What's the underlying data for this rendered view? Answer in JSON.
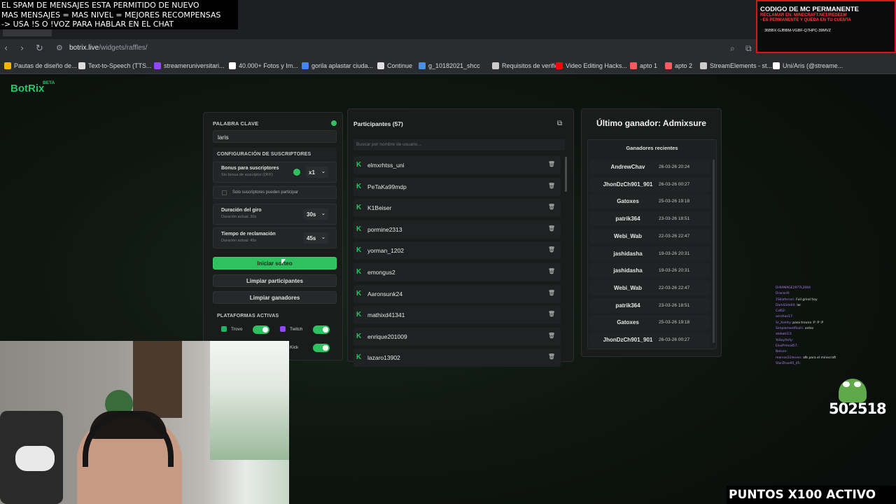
{
  "overlay": {
    "spam_lines": [
      "EL SPAM DE MENSAJES ESTA PERMITIDO DE NUEVO",
      "MAS MENSAJES = MAS NIVEL = MEJORES RECOMPENSAS",
      "-> USA !S  O !VOZ PARA HABLAR EN EL CHAT"
    ],
    "mc_title": "CODIGO DE MC PERMANENTE",
    "mc_line1": "RECLAMAR EN: MINECRAFT.NET/REDEEM",
    "mc_line2": "- ES PERMANENTE Y QUEDA EN TU CUENTA",
    "mc_code": "36BBX-GJBBM-VGBF-Q7HPC-39MVZ",
    "points_number": "502518",
    "puntos_banner": "PUNTOS X100 ACTIVO"
  },
  "browser": {
    "url_domain": "botrix.live",
    "url_path": "/widgets/raffles/",
    "bookmarks": [
      {
        "label": "Pautas de diseño de...",
        "color": "#f4b400"
      },
      {
        "label": "Text-to-Speech (TTS...",
        "color": "#dddddd"
      },
      {
        "label": "streameruniversitari...",
        "color": "#9146ff"
      },
      {
        "label": "40.000+ Fotos y Im...",
        "color": "#ffffff"
      },
      {
        "label": "gorila aplastar ciuda...",
        "color": "#4285f4"
      },
      {
        "label": "Continue",
        "color": "#e0e0e0"
      },
      {
        "label": "g_10182021_shcc",
        "color": "#4a90e2"
      },
      {
        "label": "Requisitos de verific...",
        "color": "#cccccc"
      },
      {
        "label": "Video Editing Hacks...",
        "color": "#ff0000"
      },
      {
        "label": "apto 1",
        "color": "#ff5a5f"
      },
      {
        "label": "apto 2",
        "color": "#ff5a5f"
      },
      {
        "label": "StreamElements - st...",
        "color": "#cccccc"
      },
      {
        "label": "Uni/Aris (@streame...",
        "color": "#ffffff"
      }
    ]
  },
  "brand": {
    "name": "BotRix",
    "badge": "BETA"
  },
  "settings": {
    "keyword_label": "PALABRA CLAVE",
    "keyword_value": "laris",
    "subs_section": "CONFIGURACIÓN DE SUSCRIPTORES",
    "sub_bonus_label": "Bonus para suscriptores",
    "sub_bonus_sub": "Sin bonus de suscriptor (OFF)",
    "sub_bonus_value": "x1",
    "subs_only_label": "Solo suscriptores pueden participar",
    "spin_label": "Duración del giro",
    "spin_sub": "Duración actual: 30s",
    "spin_value": "30s",
    "claim_label": "Tiempo de reclamación",
    "claim_sub": "Duración actual: 45s",
    "claim_value": "45s",
    "start_button": "Iniciar sorteo",
    "clear_participants": "Limpiar participantes",
    "clear_winners": "Limpiar ganadores",
    "platforms_label": "PLATAFORMAS ACTIVAS",
    "platform_trovo": "Trovo",
    "platform_twitch": "Twitch",
    "platform_kick": "Kick"
  },
  "participants": {
    "title": "Participantes (57)",
    "search_placeholder": "Buscar por nombre de usuario...",
    "items": [
      "elmxrhtss_uni",
      "PeTaKa99mdp",
      "K1Beiser",
      "pormine2313",
      "yorman_1202",
      "emongus2",
      "Aaronsunk24",
      "mathixd41341",
      "enrique201009",
      "lazaro13902"
    ]
  },
  "winners": {
    "last_winner": "Último ganador: Admixsure",
    "recent_title": "Ganadores recientes",
    "items": [
      {
        "name": "AndrewChav",
        "date": "26-03-26 20:24"
      },
      {
        "name": "JhonDzCh901_901",
        "date": "26-03-26 00:27"
      },
      {
        "name": "Gatoxes",
        "date": "25-03-26 19:18"
      },
      {
        "name": "patrik364",
        "date": "23-03-26 18:51"
      },
      {
        "name": "Webi_Wab",
        "date": "22-03-26 22:47"
      },
      {
        "name": "jashidasha",
        "date": "19-03-26 20:31"
      },
      {
        "name": "jashidasha",
        "date": "19-03-26 20:31"
      },
      {
        "name": "Webi_Wab",
        "date": "22-03-26 22:47"
      },
      {
        "name": "patrik364",
        "date": "23-03-26 18:51"
      },
      {
        "name": "Gatoxes",
        "date": "25-03-26 19:18"
      },
      {
        "name": "JhonDzCh901_901",
        "date": "26-03-26 00:27"
      }
    ]
  },
  "chat": [
    {
      "user": "DrRAMAGE1977L2004",
      "msg": ""
    },
    {
      "user": "Dracon9:",
      "msg": ""
    },
    {
      "user": "1Sklaferrari:",
      "msg": "Full grind hoy"
    },
    {
      "user": "DarkSlide04:",
      "msg": "lar"
    },
    {
      "user": "Cal62:",
      "msg": ""
    },
    {
      "user": "acrohan17:",
      "msg": ""
    },
    {
      "user": "Sr_Xomty:",
      "msg": "pasa trouna :P :P :P"
    },
    {
      "user": "SimplementRodri:",
      "msg": "ontes"
    },
    {
      "user": "alebaki13:",
      "msg": ""
    },
    {
      "user": "YoSoyYorly:",
      "msg": ""
    },
    {
      "user": "ElsoPrimo857:",
      "msg": ""
    },
    {
      "user": "Nelson:",
      "msg": ""
    },
    {
      "user": "marcos22deven:",
      "msg": "afk para el minecraft"
    },
    {
      "user": "StarZhao95_45:",
      "msg": ""
    }
  ]
}
